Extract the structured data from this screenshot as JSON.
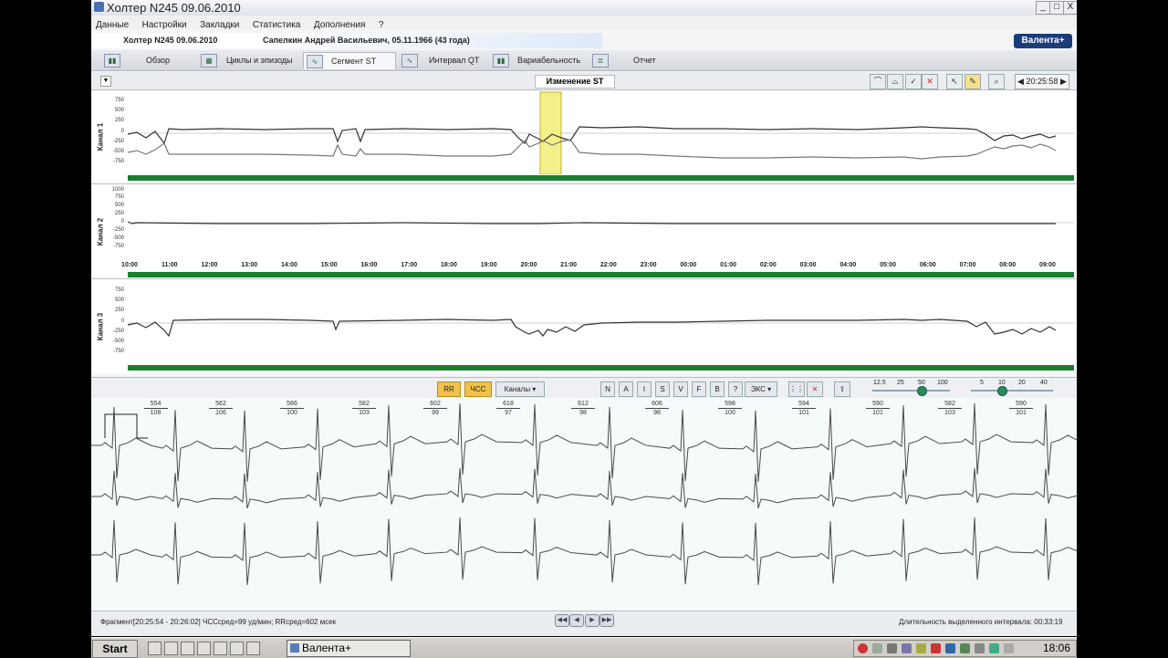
{
  "window": {
    "title": "Холтер  N245  09.06.2010",
    "buttons": [
      "_",
      "□",
      "X"
    ]
  },
  "menu": [
    "Данные",
    "Настройки",
    "Закладки",
    "Статистика",
    "Дополнения",
    "?"
  ],
  "patient": {
    "record": "Холтер  N245  09.06.2010",
    "name": "Сапелкин Андрей Васильевич, 05.11.1966 (43 года)"
  },
  "logo": "Валента+",
  "tabs": [
    {
      "label": "Обзор",
      "icon": "bar-chart-icon"
    },
    {
      "label": "Циклы и эпизоды",
      "icon": "cycles-icon"
    },
    {
      "label": "Сегмент ST",
      "icon": "st-segment-icon",
      "active": true
    },
    {
      "label": "Интервал QT",
      "icon": "qt-interval-icon"
    },
    {
      "label": "Вариабельность",
      "icon": "variability-icon"
    },
    {
      "label": "Отчет",
      "icon": "report-icon"
    }
  ],
  "trend_panel": {
    "title": "Изменение ST",
    "time": "20:25:58",
    "channels": [
      {
        "label": "Канал 1",
        "yticks": [
          "750",
          "500",
          "250",
          "0",
          "-250",
          "-500",
          "-750"
        ]
      },
      {
        "label": "Канал 2",
        "yticks": [
          "1000",
          "750",
          "500",
          "250",
          "0",
          "-250",
          "-500",
          "-750"
        ]
      },
      {
        "label": "Канал 3",
        "yticks": [
          "750",
          "500",
          "250",
          "0",
          "-250",
          "-500",
          "-750"
        ]
      }
    ],
    "xticks": [
      "10:00",
      "11:00",
      "12:00",
      "13:00",
      "14:00",
      "15:00",
      "16:00",
      "17:00",
      "18:00",
      "19:00",
      "20:00",
      "21:00",
      "22:00",
      "23:00",
      "00:00",
      "01:00",
      "02:00",
      "03:00",
      "04:00",
      "05:00",
      "06:00",
      "07:00",
      "08:00",
      "09:00"
    ]
  },
  "ecg_toolbar": {
    "rr": "RR",
    "hr": "ЧСС",
    "channels": "Каналы",
    "beat_types": [
      "N",
      "A",
      "I",
      "S",
      "V",
      "F",
      "B",
      "?",
      "ЭКС"
    ],
    "speed_scale": [
      "12.5",
      "25",
      "50",
      "100"
    ],
    "amp_scale": [
      "5",
      "10",
      "20",
      "40"
    ]
  },
  "ecg_labels": [
    {
      "rr": "554",
      "hr": "108"
    },
    {
      "rr": "562",
      "hr": "106"
    },
    {
      "rr": "586",
      "hr": "100"
    },
    {
      "rr": "582",
      "hr": "103"
    },
    {
      "rr": "602",
      "hr": "99"
    },
    {
      "rr": "618",
      "hr": "97"
    },
    {
      "rr": "612",
      "hr": "98"
    },
    {
      "rr": "606",
      "hr": "98"
    },
    {
      "rr": "598",
      "hr": "100"
    },
    {
      "rr": "594",
      "hr": "101"
    },
    {
      "rr": "590",
      "hr": "101"
    },
    {
      "rr": "582",
      "hr": "103"
    },
    {
      "rr": "590",
      "hr": "101"
    }
  ],
  "status": {
    "fragment": "Фрагмент[20:25:54 - 20:26:02]  ЧССсред=99 уд/мин;  RRсред=602 мсек",
    "duration": "Длительность выделенного интервала: 00:33:19"
  },
  "taskbar": {
    "start": "Start",
    "task": "Валента+",
    "clock": "18:06"
  },
  "colors": {
    "window_bg": "#f4f5f7",
    "trend_green": "#1b7e2e",
    "selection": "#f3f08a",
    "ecg_trace": "#4a4a4a",
    "ecg_bg": "#f4fbfa",
    "button_yellow": "#f0c24a"
  }
}
